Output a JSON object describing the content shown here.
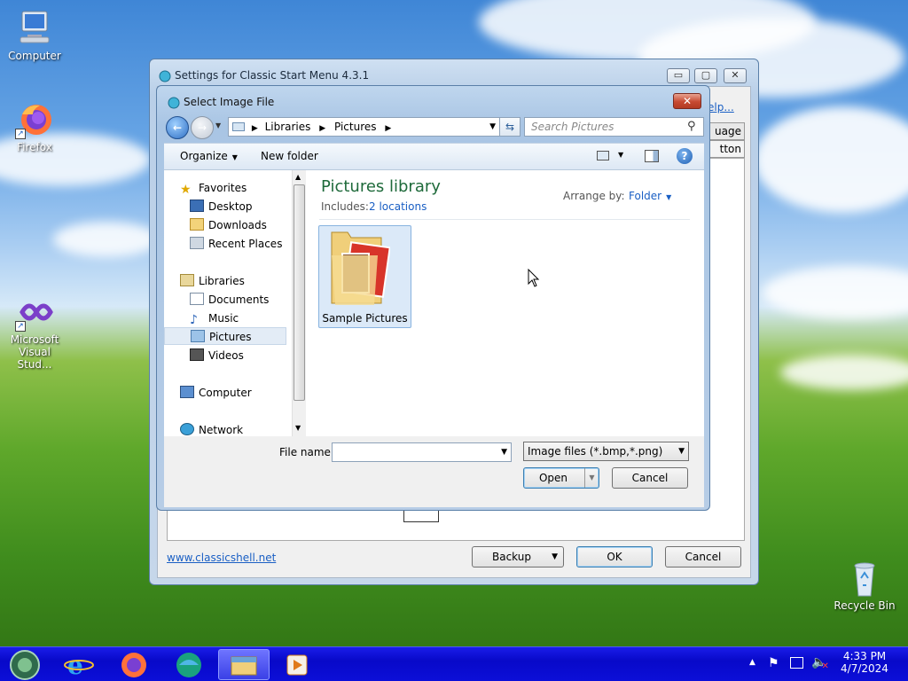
{
  "desktop": {
    "icons": [
      {
        "label": "Computer",
        "icon": "computer-icon"
      },
      {
        "label": "Firefox",
        "icon": "firefox-icon"
      },
      {
        "label_line1": "Microsoft",
        "label_line2": "Visual Stud...",
        "icon": "visual-studio-icon"
      },
      {
        "label": "Recycle Bin",
        "icon": "recycle-bin-icon"
      }
    ]
  },
  "back_window": {
    "title": "Settings for Classic Start Menu 4.3.1",
    "link": "www.classicshell.net",
    "partial_text": {
      "help": "elp...",
      "language": "uage",
      "button": "tton"
    },
    "buttons": {
      "backup": "Backup",
      "ok": "OK",
      "cancel": "Cancel"
    },
    "window_buttons": {
      "minimize": "▭",
      "maximize": "▢",
      "close": "✕"
    }
  },
  "dialog": {
    "title": "Select Image File",
    "close": "✕",
    "breadcrumb": [
      "Libraries",
      "Pictures"
    ],
    "search_placeholder": "Search Pictures",
    "toolbar": {
      "organize": "Organize",
      "new_folder": "New folder"
    },
    "nav": {
      "favorites": "Favorites",
      "favorites_items": [
        "Desktop",
        "Downloads",
        "Recent Places"
      ],
      "libraries": "Libraries",
      "libraries_items": [
        "Documents",
        "Music",
        "Pictures",
        "Videos"
      ],
      "computer": "Computer",
      "network": "Network",
      "selected": "Pictures"
    },
    "library_title": "Pictures library",
    "includes_label": "Includes:",
    "includes_link": "2 locations",
    "arrange_label": "Arrange by:",
    "arrange_value": "Folder",
    "folder_item": "Sample Pictures",
    "file_name_label": "File name:",
    "file_name_value": "",
    "file_type": "Image files (*.bmp,*.png)",
    "open_button": "Open",
    "cancel_button": "Cancel"
  },
  "taskbar": {
    "time": "4:33 PM",
    "date": "4/7/2024"
  }
}
